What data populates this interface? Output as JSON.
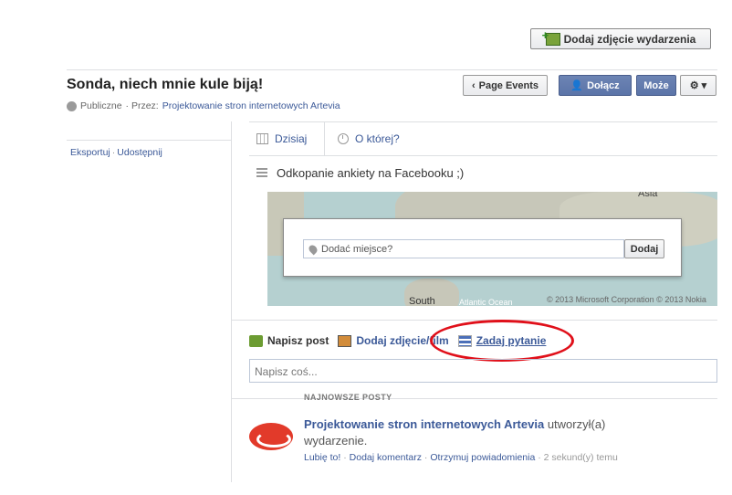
{
  "header": {
    "add_photo_label": "Dodaj zdjęcie wydarzenia"
  },
  "event": {
    "title": "Sonda, niech mnie kule biją!",
    "privacy": "Publiczne",
    "by_prefix": "· Przez:",
    "organizer": "Projektowanie stron internetowych Artevia"
  },
  "actions": {
    "page_events": "Page Events",
    "join": "Dołącz",
    "maybe": "Może",
    "gear": "⚙ ▾"
  },
  "sidebar": {
    "export": "Eksportuj",
    "sep": "·",
    "share": "Udostępnij"
  },
  "details": {
    "date": "Dzisiaj",
    "time": "O której?",
    "description": "Odkopanie ankiety na Facebooku ;)"
  },
  "map": {
    "asia": "Asia",
    "south": "South",
    "ocean": "Atlantic Ocean",
    "copyright": "© 2013 Microsoft Corporation © 2013 Nokia",
    "place_placeholder": "Dodać miejsce?",
    "place_add": "Dodaj"
  },
  "composer": {
    "post_tab": "Napisz post",
    "photo_tab": "Dodaj zdjęcie/film",
    "ask_tab": "Zadaj pytanie",
    "input_placeholder": "Napisz coś..."
  },
  "feed": {
    "section_label": "NAJNOWSZE POSTY",
    "post": {
      "author": "Projektowanie stron internetowych Artevia",
      "text": " utworzył(a) wydarzenie.",
      "like": "Lubię to!",
      "comment": "Dodaj komentarz",
      "notify": "Otrzymuj powiadomienia",
      "time": "2 sekund(y) temu",
      "sep": " · "
    }
  },
  "colors": {
    "link": "#3b5998",
    "button_blue": "#5b74a8",
    "annotation_red": "#e0101a"
  }
}
